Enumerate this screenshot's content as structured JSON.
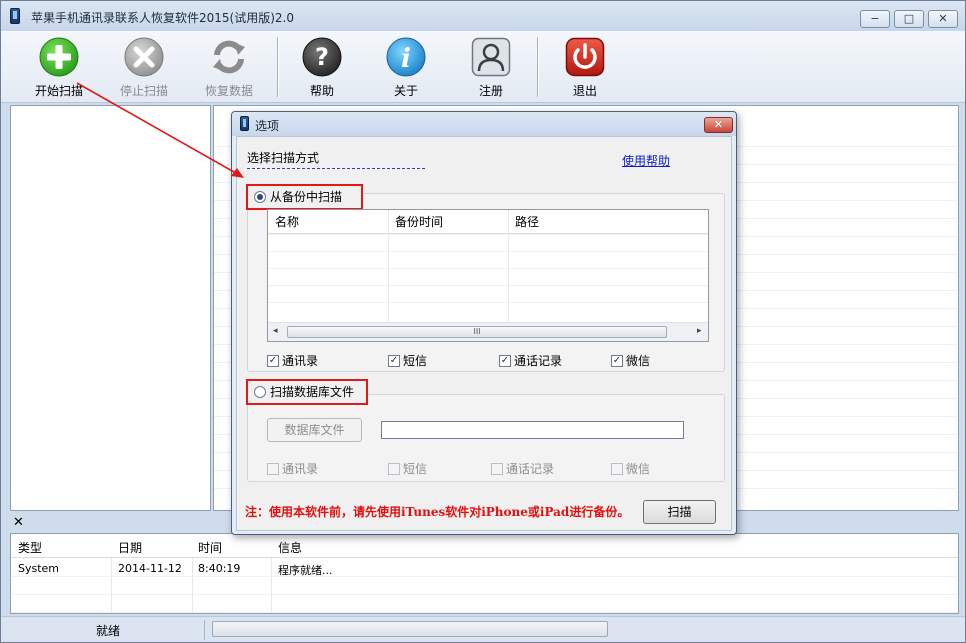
{
  "window": {
    "title": "苹果手机通讯录联系人恢复软件2015(试用版)2.0",
    "controls": {
      "minimize": "−",
      "maximize": "□",
      "close": "✕"
    }
  },
  "toolbar": {
    "buttons": [
      {
        "label": "开始扫描",
        "icon": "plus-icon",
        "enabled": true
      },
      {
        "label": "停止扫描",
        "icon": "stop-icon",
        "enabled": false
      },
      {
        "label": "恢复数据",
        "icon": "refresh-icon",
        "enabled": false
      },
      {
        "label": "帮助",
        "icon": "help-icon",
        "enabled": true
      },
      {
        "label": "关于",
        "icon": "info-icon",
        "enabled": true
      },
      {
        "label": "注册",
        "icon": "user-icon",
        "enabled": true
      },
      {
        "label": "退出",
        "icon": "power-icon",
        "enabled": true
      }
    ]
  },
  "dialog": {
    "title": "选项",
    "close": "✕",
    "scan_mode_label": "选择扫描方式",
    "help_link": "使用帮助",
    "option_backup": {
      "label": "从备份中扫描",
      "selected": true,
      "table_headers": [
        "名称",
        "备份时间",
        "路径"
      ],
      "scroll_thumb": "III",
      "scroll_left": "◂",
      "scroll_right": "▸",
      "checkboxes": [
        {
          "label": "通讯录",
          "checked": true
        },
        {
          "label": "短信",
          "checked": true
        },
        {
          "label": "通话记录",
          "checked": true
        },
        {
          "label": "微信",
          "checked": true
        }
      ]
    },
    "option_db": {
      "label": "扫描数据库文件",
      "selected": false,
      "db_button": "数据库文件",
      "db_path": "",
      "checkboxes": [
        {
          "label": "通讯录",
          "checked": false
        },
        {
          "label": "短信",
          "checked": false
        },
        {
          "label": "通话记录",
          "checked": false
        },
        {
          "label": "微信",
          "checked": false
        }
      ]
    },
    "note": "注：使用本软件前，请先使用iTunes软件对iPhone或iPad进行备份。",
    "scan_button": "扫描"
  },
  "log": {
    "close": "✕",
    "headers": [
      "类型",
      "日期",
      "时间",
      "信息"
    ],
    "rows": [
      {
        "type": "System",
        "date": "2014-11-12",
        "time": "8:40:19",
        "message": "程序就绪..."
      }
    ]
  },
  "status": {
    "text": "就绪"
  },
  "colors": {
    "annotation_red": "#e01a1a",
    "link_blue": "#0a1ec8",
    "note_red": "#e01010"
  }
}
